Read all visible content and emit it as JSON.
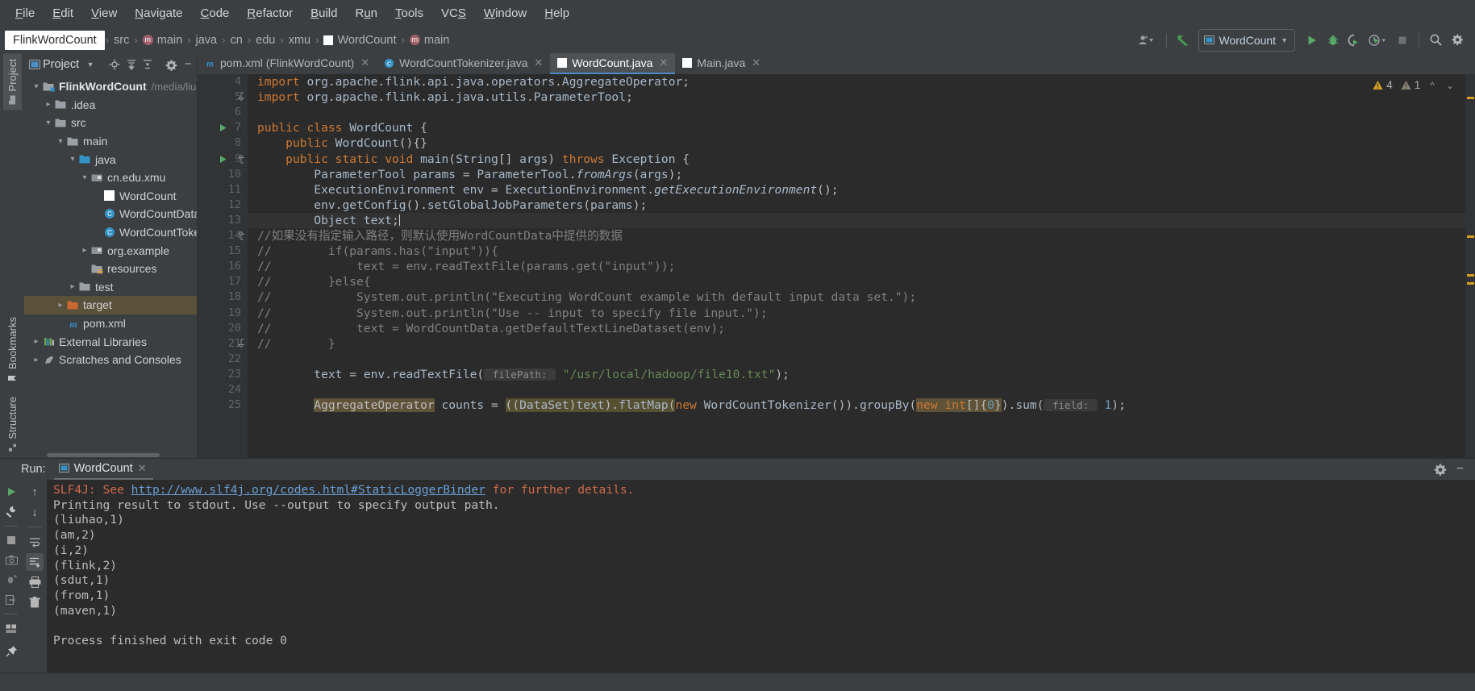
{
  "menubar": {
    "items": [
      {
        "label": "File",
        "accel": "F"
      },
      {
        "label": "Edit",
        "accel": "E"
      },
      {
        "label": "View",
        "accel": "V"
      },
      {
        "label": "Navigate",
        "accel": "N"
      },
      {
        "label": "Code",
        "accel": "C"
      },
      {
        "label": "Refactor",
        "accel": "R"
      },
      {
        "label": "Build",
        "accel": "B"
      },
      {
        "label": "Run",
        "accel": "u"
      },
      {
        "label": "Tools",
        "accel": "T"
      },
      {
        "label": "VCS",
        "accel": "S"
      },
      {
        "label": "Window",
        "accel": "W"
      },
      {
        "label": "Help",
        "accel": "H"
      }
    ]
  },
  "navbar": {
    "project_name": "FlinkWordCount",
    "breadcrumbs": [
      "src",
      "main",
      "java",
      "cn",
      "edu",
      "xmu",
      "WordCount",
      "main"
    ],
    "separator": "›",
    "run_config": "WordCount",
    "icons": {
      "profile": "user-dropdown-icon",
      "update": "update-project-icon",
      "run": "run-icon",
      "debug": "debug-icon",
      "coverage": "run-with-coverage-icon",
      "profiler": "profiler-icon",
      "stop": "stop-icon",
      "search": "search-everywhere-icon",
      "settings": "settings-gear-icon"
    }
  },
  "left_strip": {
    "top_tab": "Project",
    "bottom_tabs": [
      "Bookmarks",
      "Structure"
    ]
  },
  "project_panel": {
    "title": "Project",
    "toolbar_icons": [
      "chevron-down-icon",
      "locate-icon",
      "expand-all-icon",
      "collapse-all-icon",
      "gear-icon",
      "minimize-icon"
    ],
    "tree": [
      {
        "depth": 0,
        "twist": "v",
        "icon": "module-folder",
        "label": "FlinkWordCount",
        "path": "/media/liuh",
        "bold": true,
        "selected": false
      },
      {
        "depth": 1,
        "twist": ">",
        "icon": "folder",
        "label": ".idea",
        "path": "",
        "bold": false,
        "selected": false
      },
      {
        "depth": 1,
        "twist": "v",
        "icon": "folder",
        "label": "src",
        "path": "",
        "bold": false,
        "selected": false
      },
      {
        "depth": 2,
        "twist": "v",
        "icon": "folder",
        "label": "main",
        "path": "",
        "bold": false,
        "selected": false
      },
      {
        "depth": 3,
        "twist": "v",
        "icon": "source-folder",
        "label": "java",
        "path": "",
        "bold": false,
        "selected": false
      },
      {
        "depth": 4,
        "twist": "v",
        "icon": "package",
        "label": "cn.edu.xmu",
        "path": "",
        "bold": false,
        "selected": false
      },
      {
        "depth": 5,
        "twist": "",
        "icon": "file-white",
        "label": "WordCount",
        "path": "",
        "bold": false,
        "selected": false
      },
      {
        "depth": 5,
        "twist": "",
        "icon": "class",
        "label": "WordCountData",
        "path": "",
        "bold": false,
        "selected": false
      },
      {
        "depth": 5,
        "twist": "",
        "icon": "class",
        "label": "WordCountToker",
        "path": "",
        "bold": false,
        "selected": false
      },
      {
        "depth": 4,
        "twist": ">",
        "icon": "package",
        "label": "org.example",
        "path": "",
        "bold": false,
        "selected": false
      },
      {
        "depth": 4,
        "twist": "",
        "icon": "resources-folder",
        "label": "resources",
        "path": "",
        "bold": false,
        "selected": false
      },
      {
        "depth": 3,
        "twist": ">",
        "icon": "folder",
        "label": "test",
        "path": "",
        "bold": false,
        "selected": false
      },
      {
        "depth": 2,
        "twist": ">",
        "icon": "target-folder",
        "label": "target",
        "path": "",
        "bold": false,
        "selected": true
      },
      {
        "depth": 2,
        "twist": "",
        "icon": "maven",
        "label": "pom.xml",
        "path": "",
        "bold": false,
        "selected": false
      },
      {
        "depth": 0,
        "twist": ">",
        "icon": "libraries",
        "label": "External Libraries",
        "path": "",
        "bold": false,
        "selected": false
      },
      {
        "depth": 0,
        "twist": ">",
        "icon": "scratches",
        "label": "Scratches and Consoles",
        "path": "",
        "bold": false,
        "selected": false
      }
    ]
  },
  "editor": {
    "tabs": [
      {
        "label": "pom.xml (FlinkWordCount)",
        "icon": "maven-icon",
        "active": false,
        "closable": true
      },
      {
        "label": "WordCountTokenizer.java",
        "icon": "class-icon",
        "active": false,
        "closable": true
      },
      {
        "label": "WordCount.java",
        "icon": "file-white-icon",
        "active": true,
        "closable": true
      },
      {
        "label": "Main.java",
        "icon": "file-white-icon",
        "active": false,
        "closable": true
      }
    ],
    "inspection": {
      "warnings": "4",
      "weak_warnings": "1"
    },
    "first_line_number": 4,
    "caret_line": 13,
    "lines": [
      {
        "n": 4,
        "mark": "",
        "fold": "",
        "text": "import org.apache.flink.api.java.operators.AggregateOperator;"
      },
      {
        "n": 5,
        "mark": "",
        "fold": "^",
        "text": "import org.apache.flink.api.java.utils.ParameterTool;"
      },
      {
        "n": 6,
        "mark": "",
        "fold": "",
        "text": ""
      },
      {
        "n": 7,
        "mark": "run",
        "fold": "",
        "text": "public class WordCount {"
      },
      {
        "n": 8,
        "mark": "",
        "fold": "",
        "text": "    public WordCount(){}"
      },
      {
        "n": 9,
        "mark": "run",
        "fold": "-",
        "text": "    public static void main(String[] args) throws Exception {"
      },
      {
        "n": 10,
        "mark": "",
        "fold": "",
        "text": "        ParameterTool params = ParameterTool.fromArgs(args);"
      },
      {
        "n": 11,
        "mark": "",
        "fold": "",
        "text": "        ExecutionEnvironment env = ExecutionEnvironment.getExecutionEnvironment();"
      },
      {
        "n": 12,
        "mark": "",
        "fold": "",
        "text": "        env.getConfig().setGlobalJobParameters(params);"
      },
      {
        "n": 13,
        "mark": "",
        "fold": "",
        "text": "        Object text;"
      },
      {
        "n": 14,
        "mark": "",
        "fold": "-",
        "text": "        //如果没有指定输入路径，则默认使用WordCountData中提供的数据"
      },
      {
        "n": 15,
        "mark": "",
        "fold": "",
        "text": "//        if(params.has(\"input\")){"
      },
      {
        "n": 16,
        "mark": "",
        "fold": "",
        "text": "//            text = env.readTextFile(params.get(\"input\"));"
      },
      {
        "n": 17,
        "mark": "",
        "fold": "",
        "text": "//        }else{"
      },
      {
        "n": 18,
        "mark": "",
        "fold": "",
        "text": "//            System.out.println(\"Executing WordCount example with default input data set.\");"
      },
      {
        "n": 19,
        "mark": "",
        "fold": "",
        "text": "//            System.out.println(\"Use -- input to specify file input.\");"
      },
      {
        "n": 20,
        "mark": "",
        "fold": "",
        "text": "//            text = WordCountData.getDefaultTextLineDataset(env);"
      },
      {
        "n": 21,
        "mark": "",
        "fold": "^",
        "text": "//        }"
      },
      {
        "n": 22,
        "mark": "",
        "fold": "",
        "text": ""
      },
      {
        "n": 23,
        "mark": "",
        "fold": "",
        "text": "        text = env.readTextFile( filePath: \"/usr/local/hadoop/file10.txt\");"
      },
      {
        "n": 24,
        "mark": "",
        "fold": "",
        "text": ""
      },
      {
        "n": 25,
        "mark": "",
        "fold": "",
        "text": "        AggregateOperator counts = ((DataSet)text).flatMap(new WordCountTokenizer()).groupBy(new int[]{0}).sum( field: 1);"
      }
    ],
    "param_hints": [
      {
        "line": 23,
        "name": "filePath:"
      },
      {
        "line": 25,
        "name": "field:"
      }
    ]
  },
  "run_panel": {
    "label": "Run:",
    "tab_name": "WordCount",
    "side_icons_left": [
      "run-icon",
      "rerun-wrench-icon",
      "stop-icon",
      "camera-icon",
      "debug-thread-icon",
      "export-icon",
      "layout-icon",
      "pin-icon"
    ],
    "side_icons_right": [
      "scroll-up-icon",
      "scroll-down-icon",
      "soft-wrap-icon",
      "scroll-to-end-icon",
      "print-icon",
      "trash-icon"
    ],
    "header_icons": [
      "settings-gear-icon",
      "minimize-icon"
    ],
    "console": [
      {
        "type": "error",
        "prefix": "SLF4J: See ",
        "link": "http://www.slf4j.org/codes.html#StaticLoggerBinder",
        "suffix": " for further details."
      },
      {
        "type": "plain",
        "text": "Printing result to stdout. Use --output to specify output path."
      },
      {
        "type": "plain",
        "text": "(liuhao,1)"
      },
      {
        "type": "plain",
        "text": "(am,2)"
      },
      {
        "type": "plain",
        "text": "(i,2)"
      },
      {
        "type": "plain",
        "text": "(flink,2)"
      },
      {
        "type": "plain",
        "text": "(sdut,1)"
      },
      {
        "type": "plain",
        "text": "(from,1)"
      },
      {
        "type": "plain",
        "text": "(maven,1)"
      },
      {
        "type": "plain",
        "text": ""
      },
      {
        "type": "plain",
        "text": "Process finished with exit code 0"
      }
    ]
  },
  "colors": {
    "bg_panel": "#3c3f41",
    "bg_editor": "#2b2b2b",
    "gutter": "#313335",
    "accent_blue": "#4a88c7",
    "green_run": "#59a869",
    "selection_brown": "#5a513a",
    "string_green": "#6a8759",
    "keyword_orange": "#cc7832",
    "number_blue": "#6897bb",
    "comment_gray": "#808080",
    "warn_yellow": "#d6a122"
  }
}
